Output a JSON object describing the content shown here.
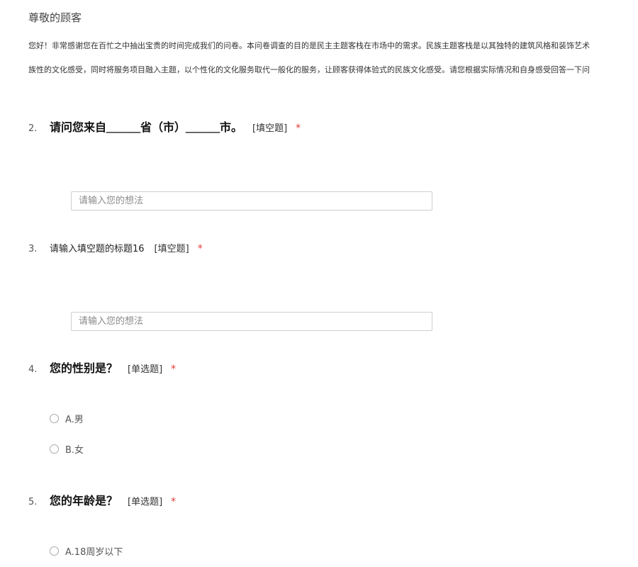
{
  "header": {
    "greeting": "尊敬的顾客",
    "intro_line1": "您好！非常感谢您在百忙之中抽出宝贵的时间完成我们的问卷。本问卷调查的目的是民主主题客栈在市场中的需求。民族主题客栈是以其独特的建筑风格和装饰艺术",
    "intro_line2": "族性的文化感受，同时将服务项目融入主题，以个性化的文化服务取代一般化的服务，让顾客获得体验式的民族文化感受。请您根据实际情况和自身感受回答一下问"
  },
  "questions": [
    {
      "number": "2.",
      "title": "请问您来自＿＿＿省（市）＿＿＿市。",
      "type": "[填空题]",
      "required": "*",
      "placeholder": "请输入您的想法"
    },
    {
      "number": "3.",
      "title": "请输入填空题的标题16",
      "type": "[填空题]",
      "required": "*",
      "placeholder": "请输入您的想法"
    },
    {
      "number": "4.",
      "title": "您的性别是？",
      "type": "[单选题]",
      "required": "*",
      "options": [
        "A.男",
        "B.女"
      ]
    },
    {
      "number": "5.",
      "title": "您的年龄是？",
      "type": "[单选题]",
      "required": "*",
      "options": [
        "A.18周岁以下"
      ]
    }
  ],
  "colors": {
    "required": "#e53935",
    "input_border": "#cfcfcf",
    "radio_border": "#a8a8a8"
  }
}
